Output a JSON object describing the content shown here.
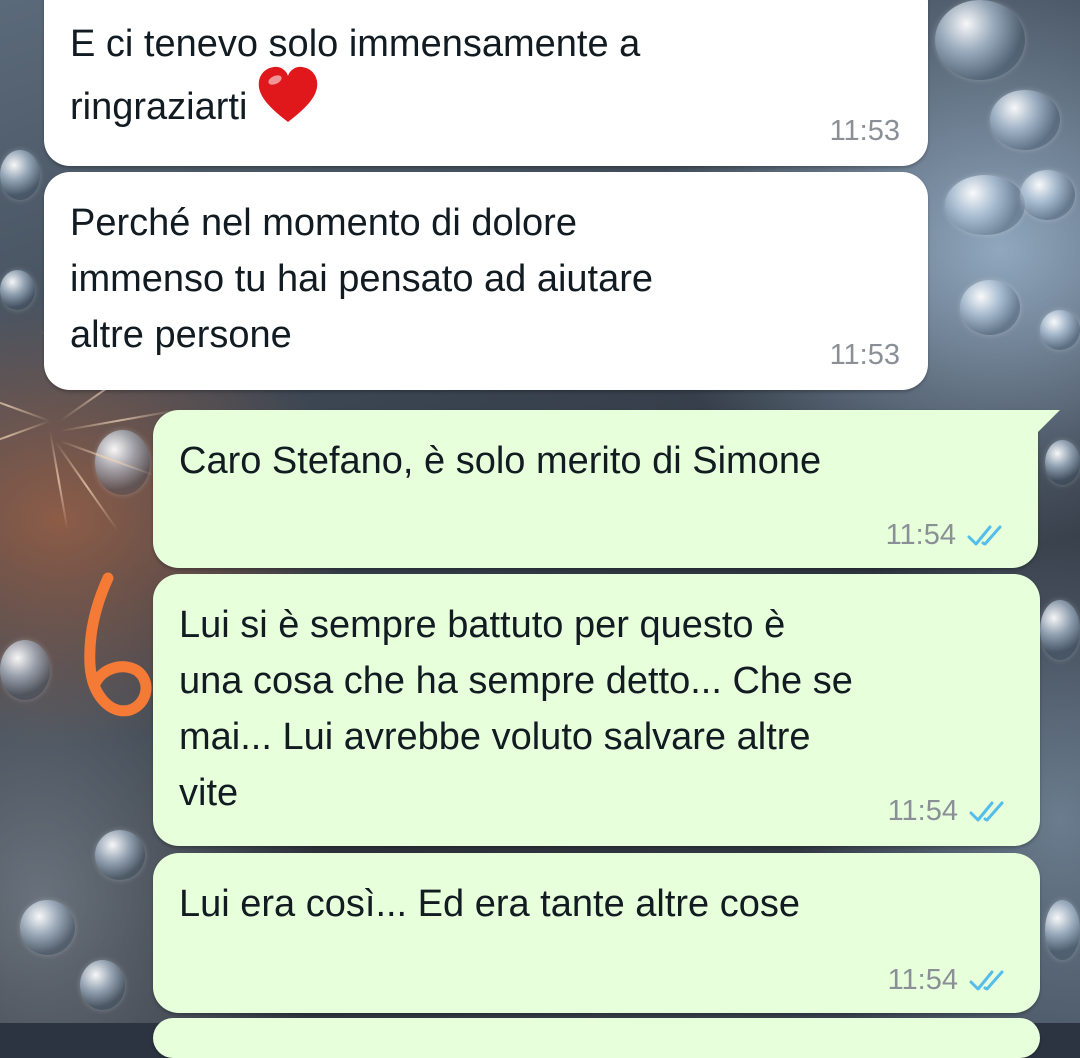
{
  "messages": [
    {
      "direction": "incoming",
      "text": "E ci tenevo solo immensamente a\nringraziarti",
      "emoji": "red-heart",
      "time": "11:53"
    },
    {
      "direction": "incoming",
      "text": "Perché nel momento di dolore\nimmenso tu hai pensato ad aiutare\naltre persone",
      "time": "11:53"
    },
    {
      "direction": "outgoing",
      "text": "Caro Stefano, è solo merito di Simone",
      "time": "11:54",
      "status": "read"
    },
    {
      "direction": "outgoing",
      "text": "Lui si è sempre battuto per questo è\nuna cosa che ha sempre detto... Che se\nmai... Lui avrebbe voluto salvare altre\nvite",
      "time": "11:54",
      "status": "read"
    },
    {
      "direction": "outgoing",
      "text": "Lui era così... Ed era tante altre cose",
      "time": "11:54",
      "status": "read"
    }
  ],
  "annotation": {
    "mark": "6",
    "color": "#f47a35"
  },
  "colors": {
    "incoming_bubble": "#ffffff",
    "outgoing_bubble": "#e7ffdb",
    "read_ticks": "#53bdeb",
    "timestamp": "#8a9096"
  }
}
